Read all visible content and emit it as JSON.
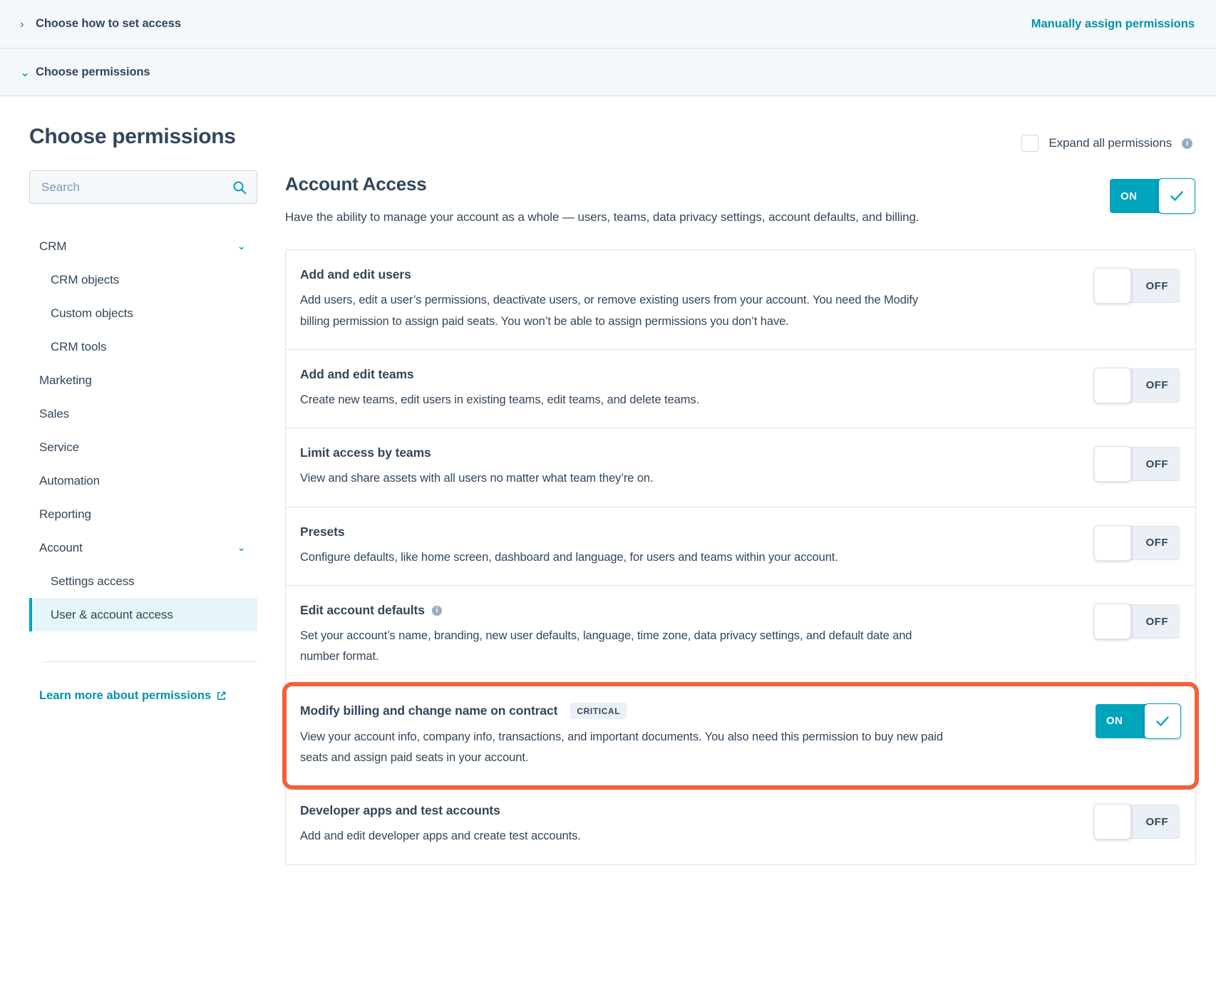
{
  "accordion": {
    "collapsed_section": {
      "label": "Choose how to set access",
      "chevron": "chevron-right"
    },
    "expanded_section": {
      "label": "Choose permissions",
      "chevron": "chevron-down"
    },
    "action_link": "Manually assign permissions"
  },
  "page": {
    "title": "Choose permissions",
    "expand_all_label": "Expand all permissions"
  },
  "search": {
    "placeholder": "Search",
    "value": ""
  },
  "sidebar": {
    "items": [
      {
        "label": "CRM",
        "level": 0,
        "expandable": true,
        "selected": false
      },
      {
        "label": "CRM objects",
        "level": 1,
        "expandable": false,
        "selected": false
      },
      {
        "label": "Custom objects",
        "level": 1,
        "expandable": false,
        "selected": false
      },
      {
        "label": "CRM tools",
        "level": 1,
        "expandable": false,
        "selected": false
      },
      {
        "label": "Marketing",
        "level": 0,
        "expandable": false,
        "selected": false
      },
      {
        "label": "Sales",
        "level": 0,
        "expandable": false,
        "selected": false
      },
      {
        "label": "Service",
        "level": 0,
        "expandable": false,
        "selected": false
      },
      {
        "label": "Automation",
        "level": 0,
        "expandable": false,
        "selected": false
      },
      {
        "label": "Reporting",
        "level": 0,
        "expandable": false,
        "selected": false
      },
      {
        "label": "Account",
        "level": 0,
        "expandable": true,
        "selected": false
      },
      {
        "label": "Settings access",
        "level": 1,
        "expandable": false,
        "selected": false
      },
      {
        "label": "User & account access",
        "level": 1,
        "expandable": false,
        "selected": true
      }
    ],
    "learn_more_link": "Learn more about permissions"
  },
  "main": {
    "section_title": "Account Access",
    "section_description": "Have the ability to manage your account as a whole — users, teams, data privacy settings, account defaults, and billing.",
    "section_toggle": {
      "state": "ON",
      "label": "ON"
    },
    "permissions": [
      {
        "title": "Add and edit users",
        "description": "Add users, edit a user’s permissions, deactivate users, or remove existing users from your account. You need the Modify billing permission to assign paid seats. You won’t be able to assign permissions you don’t have.",
        "toggle": "OFF",
        "badge": null,
        "has_info": false,
        "highlighted": false
      },
      {
        "title": "Add and edit teams",
        "description": "Create new teams, edit users in existing teams, edit teams, and delete teams.",
        "toggle": "OFF",
        "badge": null,
        "has_info": false,
        "highlighted": false
      },
      {
        "title": "Limit access by teams",
        "description": "View and share assets with all users no matter what team they’re on.",
        "toggle": "OFF",
        "badge": null,
        "has_info": false,
        "highlighted": false
      },
      {
        "title": "Presets",
        "description": "Configure defaults, like home screen, dashboard and language, for users and teams within your account.",
        "toggle": "OFF",
        "badge": null,
        "has_info": false,
        "highlighted": false
      },
      {
        "title": "Edit account defaults",
        "description": "Set your account’s name, branding, new user defaults, language, time zone, data privacy settings, and default date and number format.",
        "toggle": "OFF",
        "badge": null,
        "has_info": true,
        "highlighted": false
      },
      {
        "title": "Modify billing and change name on contract",
        "description": "View your account info, company info, transactions, and important documents. You also need this permission to buy new paid seats and assign paid seats in your account.",
        "toggle": "ON",
        "badge": "CRITICAL",
        "has_info": false,
        "highlighted": true
      },
      {
        "title": "Developer apps and test accounts",
        "description": "Add and edit developer apps and create test accounts.",
        "toggle": "OFF",
        "badge": null,
        "has_info": false,
        "highlighted": false
      }
    ]
  },
  "colors": {
    "accent_teal": "#00a4bd",
    "link_teal": "#0091ae",
    "text_dark": "#33475b",
    "highlight_orange": "#f2603c",
    "panel_bg": "#f5f8fa",
    "selected_bg": "#e5f5f8",
    "border": "#dfe3eb"
  }
}
